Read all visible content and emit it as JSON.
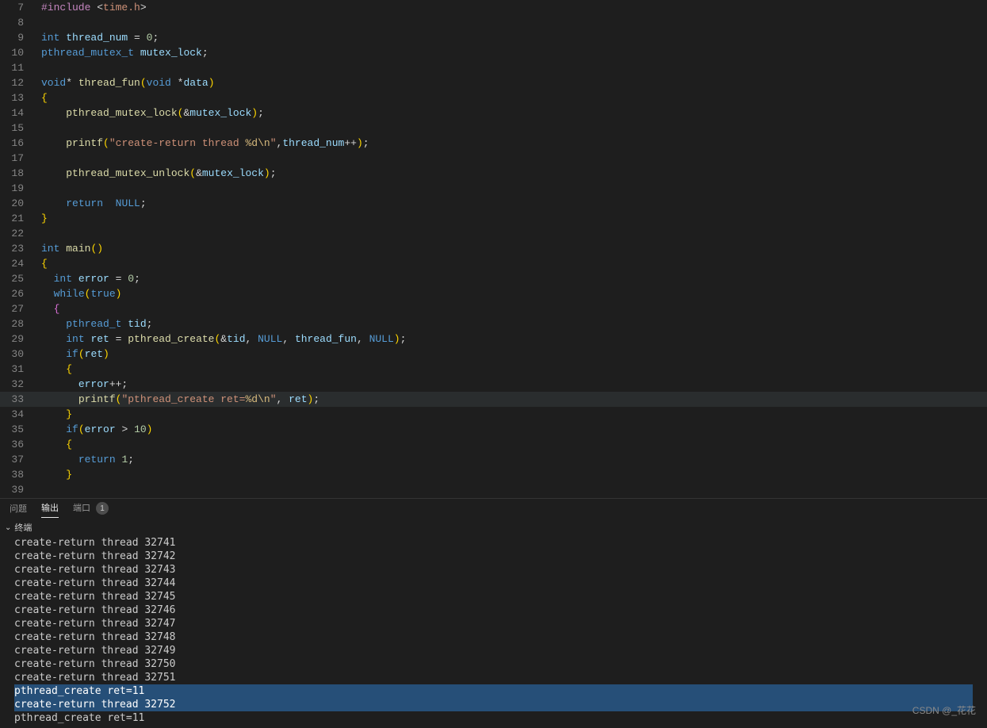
{
  "code": {
    "highlighted_line": 33,
    "lines": [
      {
        "n": 7,
        "tokens": [
          [
            "inc",
            "#include "
          ],
          [
            "pun",
            "<"
          ],
          [
            "str",
            "time.h"
          ],
          [
            "pun",
            ">"
          ]
        ]
      },
      {
        "n": 8,
        "tokens": []
      },
      {
        "n": 9,
        "tokens": [
          [
            "typ",
            "int"
          ],
          [
            "pun",
            " "
          ],
          [
            "id",
            "thread_num"
          ],
          [
            "pun",
            " = "
          ],
          [
            "num",
            "0"
          ],
          [
            "pun",
            ";"
          ]
        ]
      },
      {
        "n": 10,
        "tokens": [
          [
            "typ",
            "pthread_mutex_t"
          ],
          [
            "pun",
            " "
          ],
          [
            "id",
            "mutex_lock"
          ],
          [
            "pun",
            ";"
          ]
        ]
      },
      {
        "n": 11,
        "tokens": []
      },
      {
        "n": 12,
        "tokens": [
          [
            "typ",
            "void"
          ],
          [
            "pun",
            "* "
          ],
          [
            "fn",
            "thread_fun"
          ],
          [
            "brak",
            "("
          ],
          [
            "typ",
            "void"
          ],
          [
            "pun",
            " *"
          ],
          [
            "id",
            "data"
          ],
          [
            "brak",
            ")"
          ]
        ]
      },
      {
        "n": 13,
        "tokens": [
          [
            "brace",
            "{"
          ]
        ]
      },
      {
        "n": 14,
        "indent": 1,
        "tokens": [
          [
            "pun",
            "    "
          ],
          [
            "fn",
            "pthread_mutex_lock"
          ],
          [
            "brak",
            "("
          ],
          [
            "pun",
            "&"
          ],
          [
            "id",
            "mutex_lock"
          ],
          [
            "brak",
            ")"
          ],
          [
            "pun",
            ";"
          ]
        ]
      },
      {
        "n": 15,
        "indent": 1,
        "tokens": []
      },
      {
        "n": 16,
        "indent": 1,
        "tokens": [
          [
            "pun",
            "    "
          ],
          [
            "fn",
            "printf"
          ],
          [
            "brak",
            "("
          ],
          [
            "str",
            "\"create-return thread "
          ],
          [
            "esc",
            "%d\\n"
          ],
          [
            "str",
            "\""
          ],
          [
            "pun",
            ","
          ],
          [
            "id",
            "thread_num"
          ],
          [
            "pun",
            "++"
          ],
          [
            "brak",
            ")"
          ],
          [
            "pun",
            ";"
          ]
        ]
      },
      {
        "n": 17,
        "indent": 1,
        "tokens": []
      },
      {
        "n": 18,
        "indent": 1,
        "tokens": [
          [
            "pun",
            "    "
          ],
          [
            "fn",
            "pthread_mutex_unlock"
          ],
          [
            "brak",
            "("
          ],
          [
            "pun",
            "&"
          ],
          [
            "id",
            "mutex_lock"
          ],
          [
            "brak",
            ")"
          ],
          [
            "pun",
            ";"
          ]
        ]
      },
      {
        "n": 19,
        "indent": 1,
        "tokens": []
      },
      {
        "n": 20,
        "indent": 1,
        "tokens": [
          [
            "pun",
            "    "
          ],
          [
            "kw",
            "return"
          ],
          [
            "pun",
            "  "
          ],
          [
            "kw",
            "NULL"
          ],
          [
            "pun",
            ";"
          ]
        ]
      },
      {
        "n": 21,
        "tokens": [
          [
            "brace",
            "}"
          ]
        ]
      },
      {
        "n": 22,
        "tokens": []
      },
      {
        "n": 23,
        "tokens": [
          [
            "typ",
            "int"
          ],
          [
            "pun",
            " "
          ],
          [
            "fn",
            "main"
          ],
          [
            "brak",
            "()"
          ]
        ]
      },
      {
        "n": 24,
        "tokens": [
          [
            "brace",
            "{"
          ]
        ]
      },
      {
        "n": 25,
        "indent": 1,
        "tokens": [
          [
            "pun",
            "  "
          ],
          [
            "typ",
            "int"
          ],
          [
            "pun",
            " "
          ],
          [
            "id",
            "error"
          ],
          [
            "pun",
            " = "
          ],
          [
            "num",
            "0"
          ],
          [
            "pun",
            ";"
          ]
        ]
      },
      {
        "n": 26,
        "indent": 1,
        "tokens": [
          [
            "pun",
            "  "
          ],
          [
            "kw",
            "while"
          ],
          [
            "brak",
            "("
          ],
          [
            "kw",
            "true"
          ],
          [
            "brak",
            ")"
          ]
        ]
      },
      {
        "n": 27,
        "indent": 1,
        "tokens": [
          [
            "pun",
            "  "
          ],
          [
            "brak2",
            "{"
          ]
        ]
      },
      {
        "n": 28,
        "indent": 2,
        "tokens": [
          [
            "pun",
            "    "
          ],
          [
            "typ",
            "pthread_t"
          ],
          [
            "pun",
            " "
          ],
          [
            "id",
            "tid"
          ],
          [
            "pun",
            ";"
          ]
        ]
      },
      {
        "n": 29,
        "indent": 2,
        "tokens": [
          [
            "pun",
            "    "
          ],
          [
            "typ",
            "int"
          ],
          [
            "pun",
            " "
          ],
          [
            "id",
            "ret"
          ],
          [
            "pun",
            " = "
          ],
          [
            "fn",
            "pthread_create"
          ],
          [
            "brak",
            "("
          ],
          [
            "pun",
            "&"
          ],
          [
            "id",
            "tid"
          ],
          [
            "pun",
            ", "
          ],
          [
            "kw",
            "NULL"
          ],
          [
            "pun",
            ", "
          ],
          [
            "id",
            "thread_fun"
          ],
          [
            "pun",
            ", "
          ],
          [
            "kw",
            "NULL"
          ],
          [
            "brak",
            ")"
          ],
          [
            "pun",
            ";"
          ]
        ]
      },
      {
        "n": 30,
        "indent": 2,
        "tokens": [
          [
            "pun",
            "    "
          ],
          [
            "kw",
            "if"
          ],
          [
            "brak",
            "("
          ],
          [
            "id",
            "ret"
          ],
          [
            "brak",
            ")"
          ]
        ]
      },
      {
        "n": 31,
        "indent": 2,
        "tokens": [
          [
            "pun",
            "    "
          ],
          [
            "brak",
            "{"
          ]
        ]
      },
      {
        "n": 32,
        "indent": 3,
        "tokens": [
          [
            "pun",
            "      "
          ],
          [
            "id",
            "error"
          ],
          [
            "pun",
            "++;"
          ]
        ]
      },
      {
        "n": 33,
        "indent": 3,
        "tokens": [
          [
            "pun",
            "      "
          ],
          [
            "fn",
            "printf"
          ],
          [
            "brak",
            "("
          ],
          [
            "str",
            "\"pthread_create ret="
          ],
          [
            "esc",
            "%d\\n"
          ],
          [
            "str",
            "\""
          ],
          [
            "pun",
            ", "
          ],
          [
            "id",
            "ret"
          ],
          [
            "brak",
            ")"
          ],
          [
            "pun",
            ";"
          ]
        ]
      },
      {
        "n": 34,
        "indent": 2,
        "tokens": [
          [
            "pun",
            "    "
          ],
          [
            "brak",
            "}"
          ]
        ]
      },
      {
        "n": 35,
        "indent": 2,
        "tokens": [
          [
            "pun",
            "    "
          ],
          [
            "kw",
            "if"
          ],
          [
            "brak",
            "("
          ],
          [
            "id",
            "error"
          ],
          [
            "pun",
            " > "
          ],
          [
            "num",
            "10"
          ],
          [
            "brak",
            ")"
          ]
        ]
      },
      {
        "n": 36,
        "indent": 2,
        "tokens": [
          [
            "pun",
            "    "
          ],
          [
            "brak",
            "{"
          ]
        ]
      },
      {
        "n": 37,
        "indent": 3,
        "tokens": [
          [
            "pun",
            "      "
          ],
          [
            "kw",
            "return"
          ],
          [
            "pun",
            " "
          ],
          [
            "num",
            "1"
          ],
          [
            "pun",
            ";"
          ]
        ]
      },
      {
        "n": 38,
        "indent": 2,
        "tokens": [
          [
            "pun",
            "    "
          ],
          [
            "brak",
            "}"
          ]
        ]
      },
      {
        "n": 39,
        "indent": 1,
        "partial": true,
        "tokens": [
          [
            "pun",
            "  "
          ],
          [
            "brak2",
            ""
          ]
        ]
      }
    ]
  },
  "panel": {
    "tab_problems": "问题",
    "tab_output": "输出",
    "tab_ports": "端口",
    "port_badge": "1",
    "section_terminal": "终端"
  },
  "terminal": {
    "lines": [
      {
        "t": "create-return thread 32741",
        "sel": false
      },
      {
        "t": "create-return thread 32742",
        "sel": false
      },
      {
        "t": "create-return thread 32743",
        "sel": false
      },
      {
        "t": "create-return thread 32744",
        "sel": false
      },
      {
        "t": "create-return thread 32745",
        "sel": false
      },
      {
        "t": "create-return thread 32746",
        "sel": false
      },
      {
        "t": "create-return thread 32747",
        "sel": false
      },
      {
        "t": "create-return thread 32748",
        "sel": false
      },
      {
        "t": "create-return thread 32749",
        "sel": false
      },
      {
        "t": "create-return thread 32750",
        "sel": false
      },
      {
        "t": "create-return thread 32751",
        "sel": false
      },
      {
        "t": "pthread_create ret=11",
        "sel": true
      },
      {
        "t": "create-return thread 32752",
        "sel": true
      },
      {
        "t": "pthread_create ret=11",
        "sel": false
      }
    ]
  },
  "watermark": "CSDN @_花花"
}
